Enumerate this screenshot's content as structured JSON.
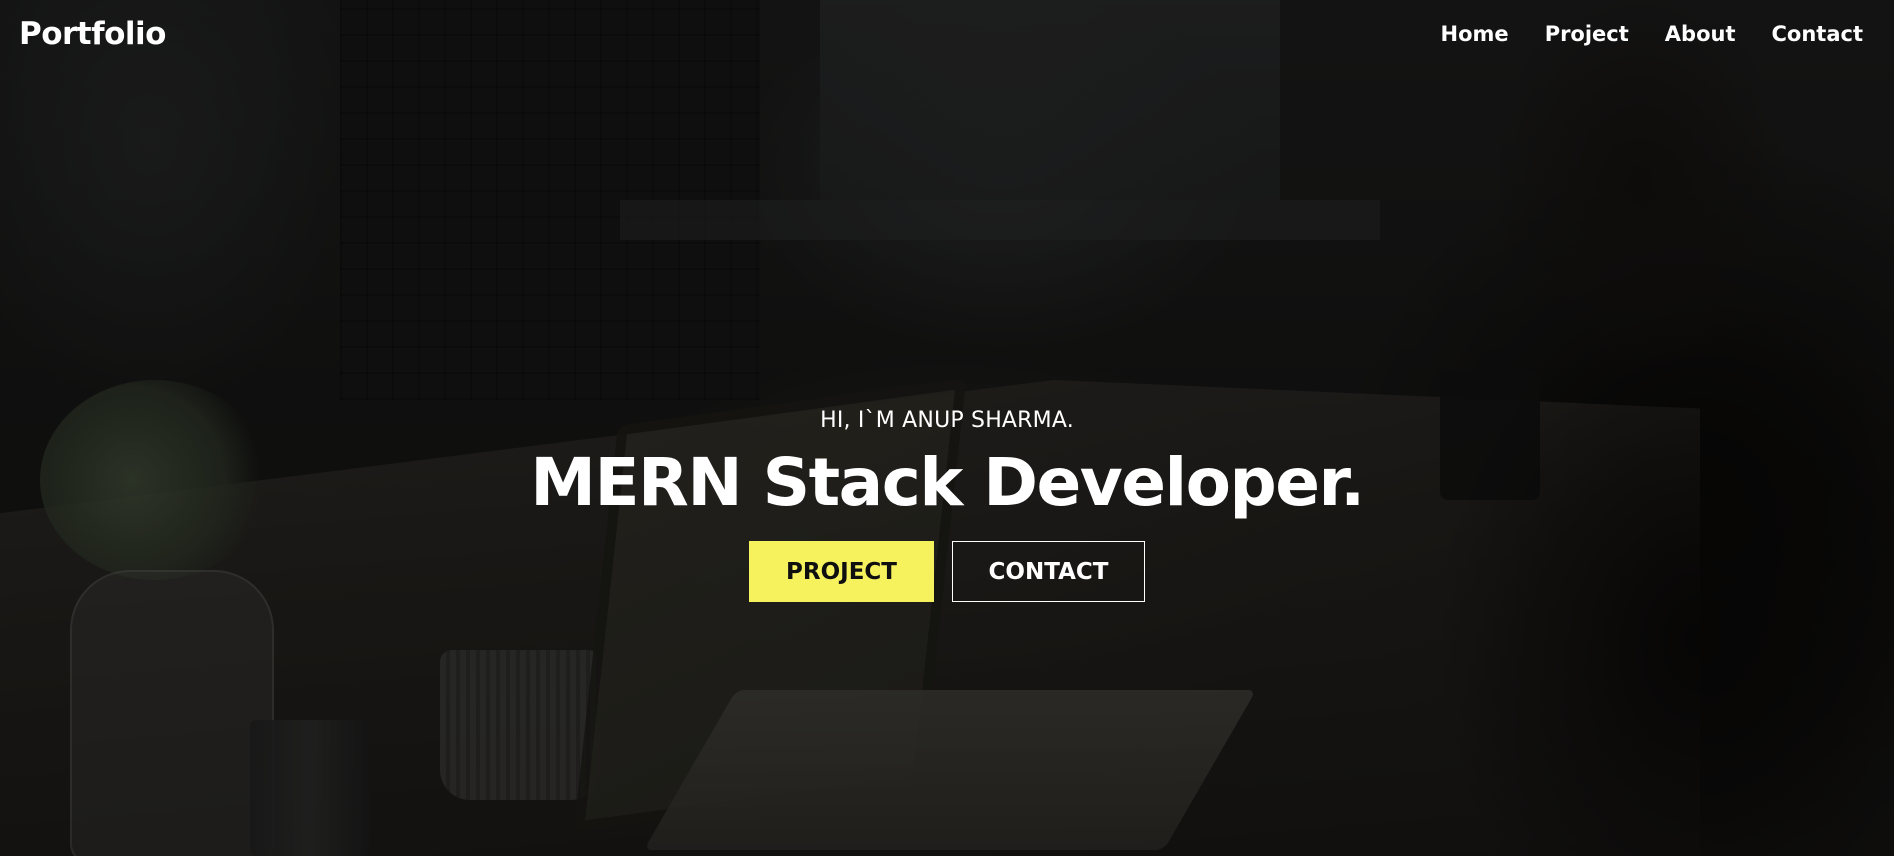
{
  "header": {
    "logo": "Portfolio",
    "nav": [
      {
        "label": "Home"
      },
      {
        "label": "Project"
      },
      {
        "label": "About"
      },
      {
        "label": "Contact"
      }
    ]
  },
  "hero": {
    "greeting": "HI, I`M ANUP SHARMA.",
    "headline": "MERN Stack Developer.",
    "buttons": {
      "primary": "PROJECT",
      "secondary": "CONTACT"
    }
  },
  "colors": {
    "accent": "#f5f25d",
    "text": "#ffffff",
    "overlay": "rgba(0,0,0,0.45)"
  }
}
